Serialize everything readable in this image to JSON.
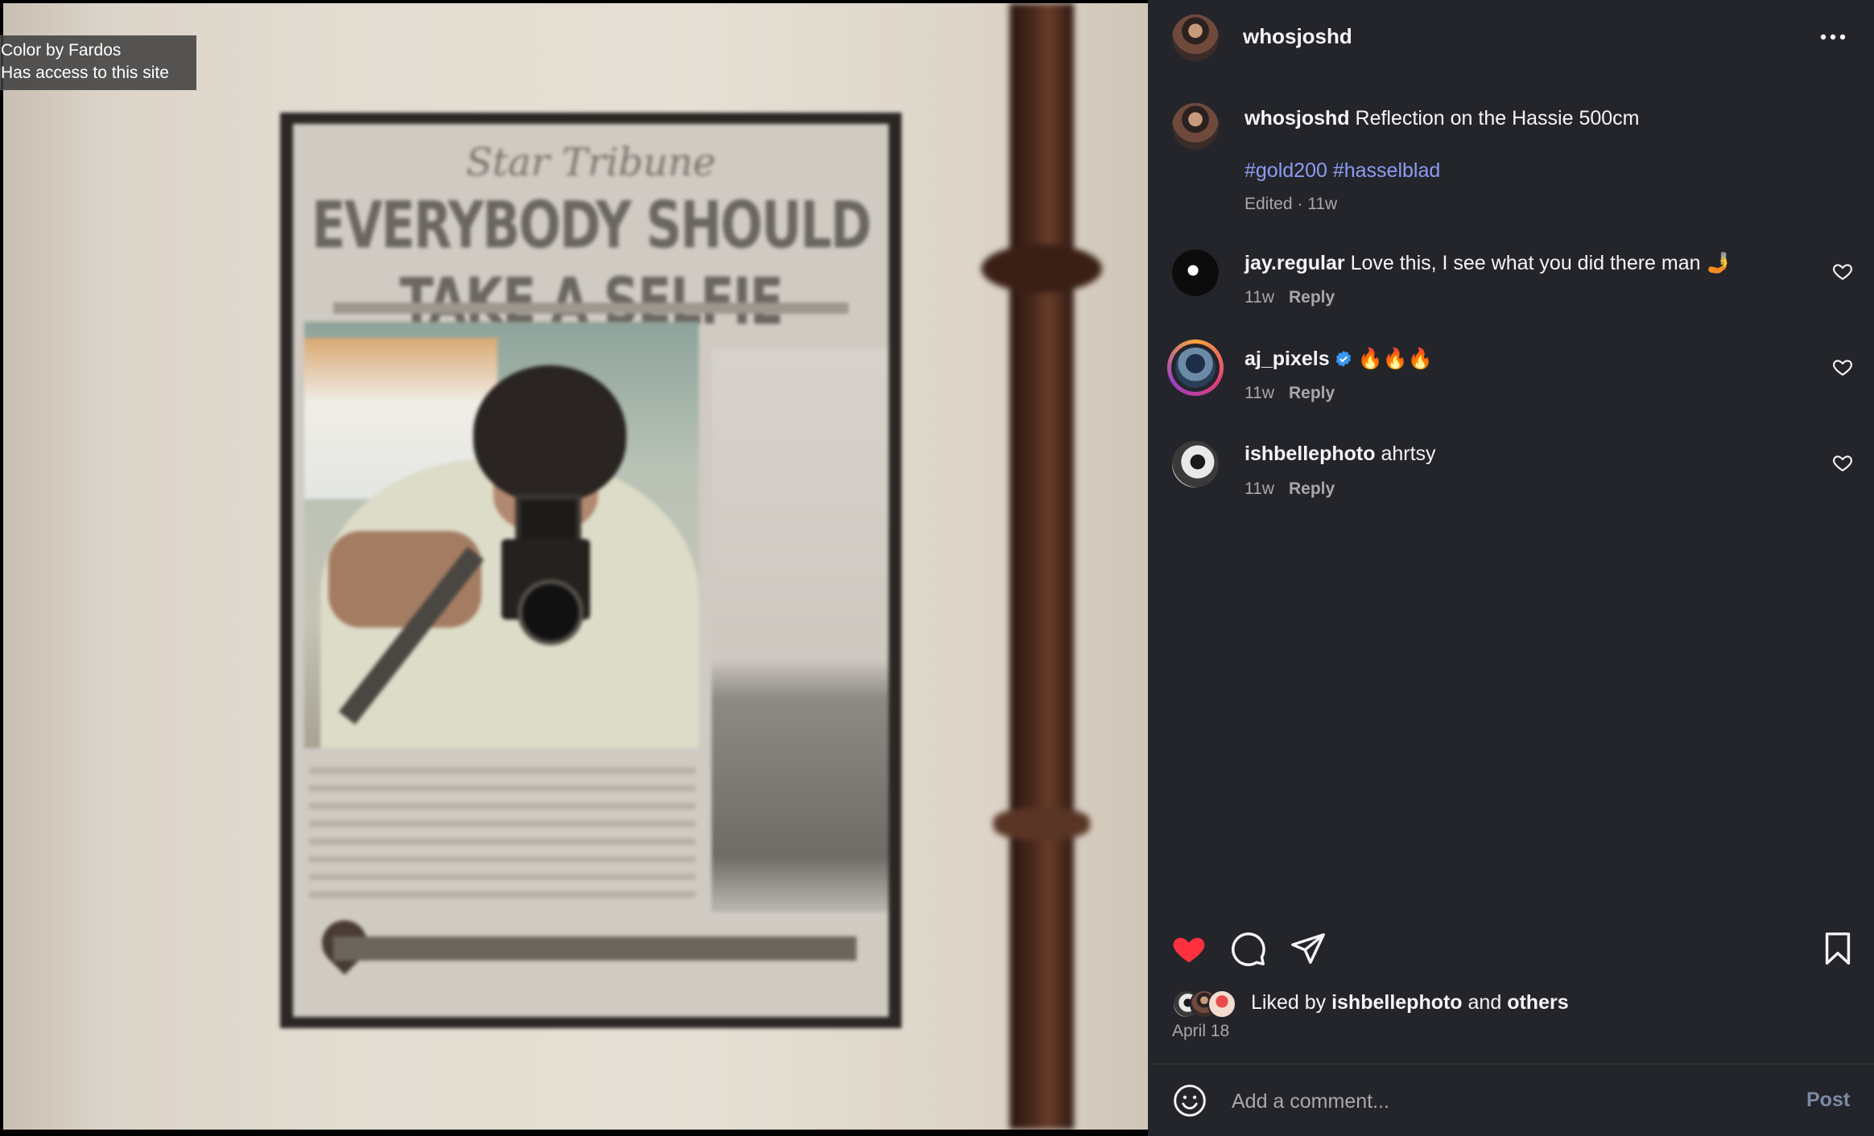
{
  "photo_tooltip": {
    "line1": "Color by Fardos",
    "line2": "Has access to this site"
  },
  "poster": {
    "masthead": "Star Tribune",
    "headline": "EVERYBODY SHOULD TAKE A SELFIE"
  },
  "post": {
    "author": "whosjoshd",
    "more_icon": "more-horizontal-icon",
    "caption_author": "whosjoshd",
    "caption_text": "Reflection on the Hassie 500cm",
    "hashtags": [
      "#gold200",
      "#hasselblad"
    ],
    "edited_meta": "Edited · 11w"
  },
  "comments": [
    {
      "user": "jay.regular",
      "text": "Love this, I see what you did there man 🤳",
      "time": "11w",
      "reply": "Reply",
      "verified": false
    },
    {
      "user": "aj_pixels",
      "text": "🔥🔥🔥",
      "time": "11w",
      "reply": "Reply",
      "verified": true
    },
    {
      "user": "ishbellephoto",
      "text": "ahrtsy",
      "time": "11w",
      "reply": "Reply",
      "verified": false
    }
  ],
  "actions": {
    "like_icon": "heart-filled-icon",
    "comment_icon": "comment-icon",
    "share_icon": "send-icon",
    "save_icon": "bookmark-icon",
    "liked_state": true
  },
  "likes": {
    "prefix": "Liked by",
    "user": "ishbellephoto",
    "and": "and",
    "others": "others",
    "date": "April 18"
  },
  "composer": {
    "placeholder": "Add a comment...",
    "post_label": "Post",
    "emoji_icon": "emoji-icon"
  },
  "colors": {
    "panel_bg": "#24252b",
    "hashtag": "#8c9cf2",
    "like_red": "#ff3040",
    "post_button": "#7c8aa6"
  }
}
